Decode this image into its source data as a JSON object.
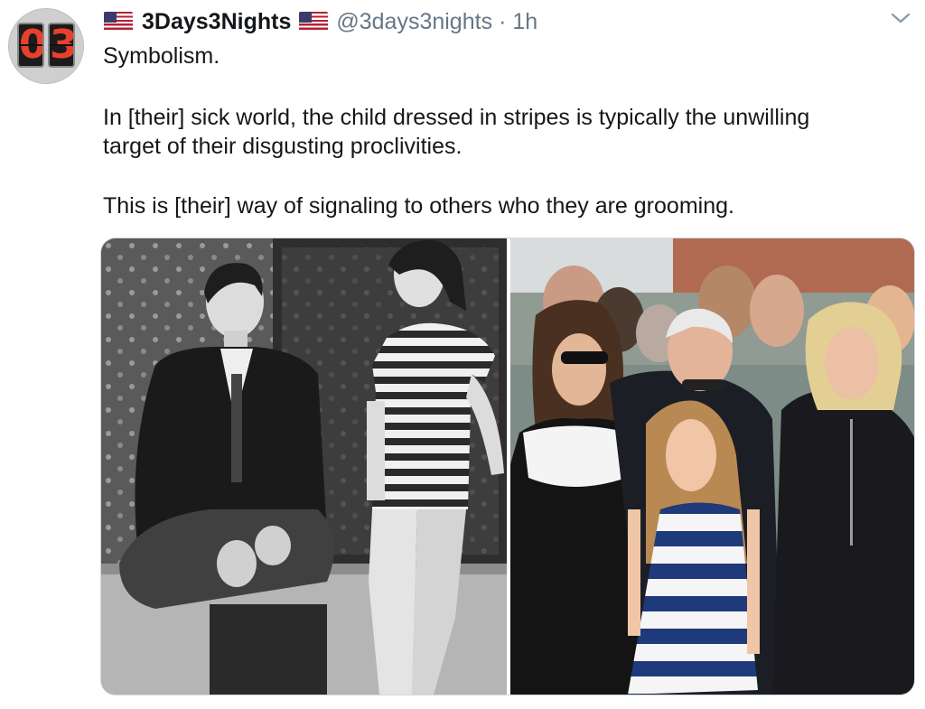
{
  "tweet": {
    "avatar": {
      "digit1": "0",
      "digit2": "3"
    },
    "display_name": "3Days3Nights",
    "handle": "@3days3nights",
    "separator": "·",
    "time": "1h",
    "icons": [
      "us-flag-icon",
      "us-flag-icon",
      "chevron-down-icon"
    ],
    "text": {
      "line1": "Symbolism.",
      "line2": "In [their] sick world, the child dressed in stripes is typically the unwilling",
      "line3": "target of their disgusting proclivities.",
      "line4": "This is [their] way of signaling to others who they are grooming."
    },
    "media": {
      "photos": [
        "black-and-white-photo",
        "color-photo"
      ]
    }
  },
  "colors": {
    "text": "#14171a",
    "secondary": "#657786",
    "border": "#cfd9de",
    "flag_red": "#b22234",
    "flag_blue": "#3c3b6e",
    "stripe_navy": "#1f3a7a"
  }
}
